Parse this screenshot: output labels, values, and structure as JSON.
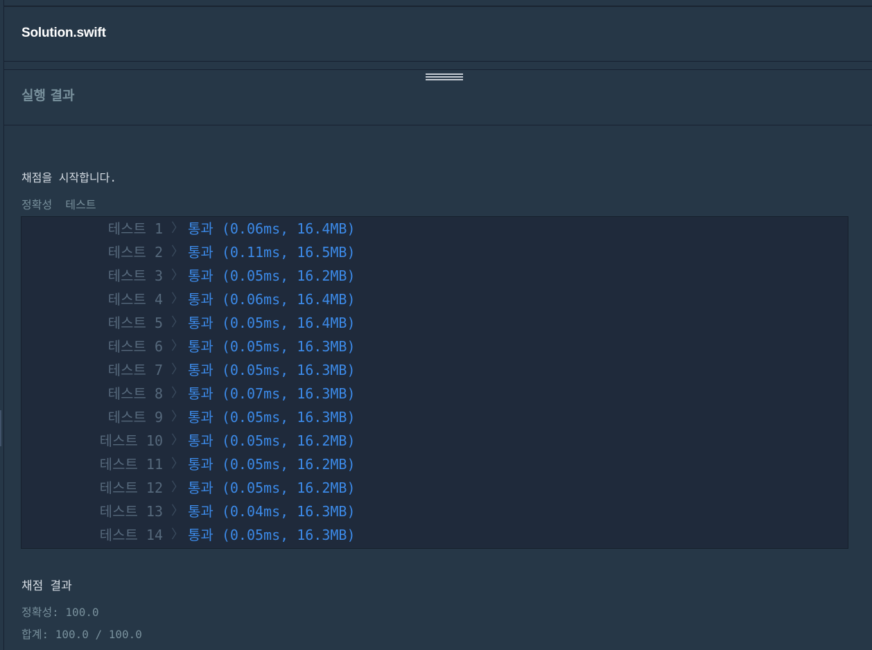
{
  "editor": {
    "filename": "Solution.swift"
  },
  "results": {
    "title": "실행 결과",
    "start_message": "채점을 시작합니다.",
    "category": "정확성  테스트",
    "tests": [
      {
        "label": "테스트 1",
        "result": "통과 (0.06ms, 16.4MB)"
      },
      {
        "label": "테스트 2",
        "result": "통과 (0.11ms, 16.5MB)"
      },
      {
        "label": "테스트 3",
        "result": "통과 (0.05ms, 16.2MB)"
      },
      {
        "label": "테스트 4",
        "result": "통과 (0.06ms, 16.4MB)"
      },
      {
        "label": "테스트 5",
        "result": "통과 (0.05ms, 16.4MB)"
      },
      {
        "label": "테스트 6",
        "result": "통과 (0.05ms, 16.3MB)"
      },
      {
        "label": "테스트 7",
        "result": "통과 (0.05ms, 16.3MB)"
      },
      {
        "label": "테스트 8",
        "result": "통과 (0.07ms, 16.3MB)"
      },
      {
        "label": "테스트 9",
        "result": "통과 (0.05ms, 16.3MB)"
      },
      {
        "label": "테스트 10",
        "result": "통과 (0.05ms, 16.2MB)"
      },
      {
        "label": "테스트 11",
        "result": "통과 (0.05ms, 16.2MB)"
      },
      {
        "label": "테스트 12",
        "result": "통과 (0.05ms, 16.2MB)"
      },
      {
        "label": "테스트 13",
        "result": "통과 (0.04ms, 16.3MB)"
      },
      {
        "label": "테스트 14",
        "result": "통과 (0.05ms, 16.3MB)"
      }
    ],
    "grade_title": "채점 결과",
    "accuracy": "정확성: 100.0",
    "total": "합계: 100.0 / 100.0"
  },
  "colors": {
    "background": "#263747",
    "console_box": "#1f2a3b",
    "pass_text": "#3c8ae8",
    "muted_text": "#78909c"
  }
}
